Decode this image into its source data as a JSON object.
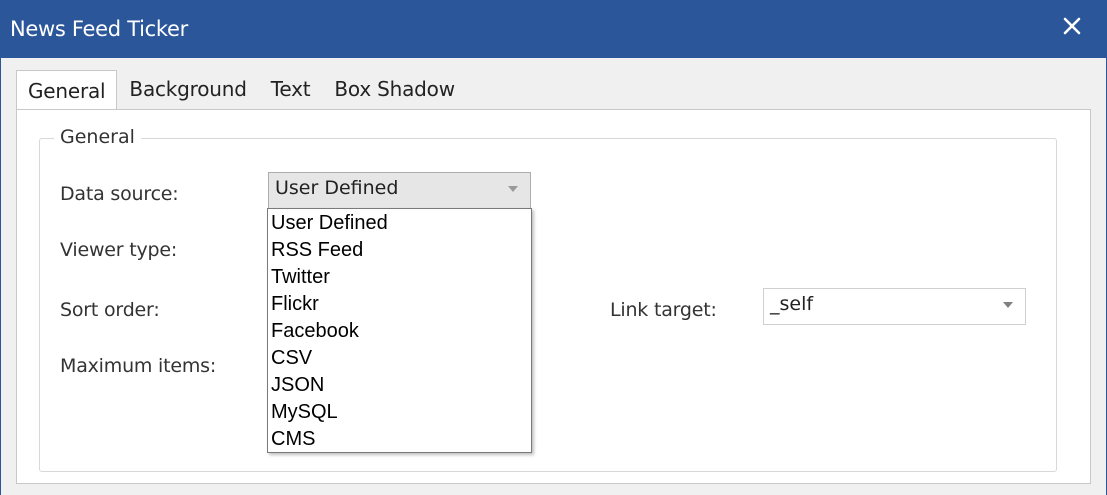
{
  "window": {
    "title": "News Feed Ticker"
  },
  "tabs": [
    {
      "label": "General",
      "active": true
    },
    {
      "label": "Background",
      "active": false
    },
    {
      "label": "Text",
      "active": false
    },
    {
      "label": "Box Shadow",
      "active": false
    }
  ],
  "group": {
    "legend": "General"
  },
  "fields": {
    "data_source": {
      "label": "Data source:",
      "value": "User Defined"
    },
    "viewer_type": {
      "label": "Viewer type:"
    },
    "sort_order": {
      "label": "Sort order:"
    },
    "maximum_items": {
      "label": "Maximum items:"
    },
    "link_target": {
      "label": "Link target:",
      "value": "_self"
    }
  },
  "dropdown": {
    "options": [
      "User Defined",
      "RSS Feed",
      "Twitter",
      "Flickr",
      "Facebook",
      "CSV",
      "JSON",
      "MySQL",
      "CMS"
    ]
  },
  "icons": {
    "close": "close-icon",
    "chevron": "chevron-down-icon"
  },
  "colors": {
    "titlebar": "#2b579a",
    "panel": "#ffffff",
    "window_bg": "#f0f0f0",
    "combo_bg": "#e6e6e6"
  }
}
